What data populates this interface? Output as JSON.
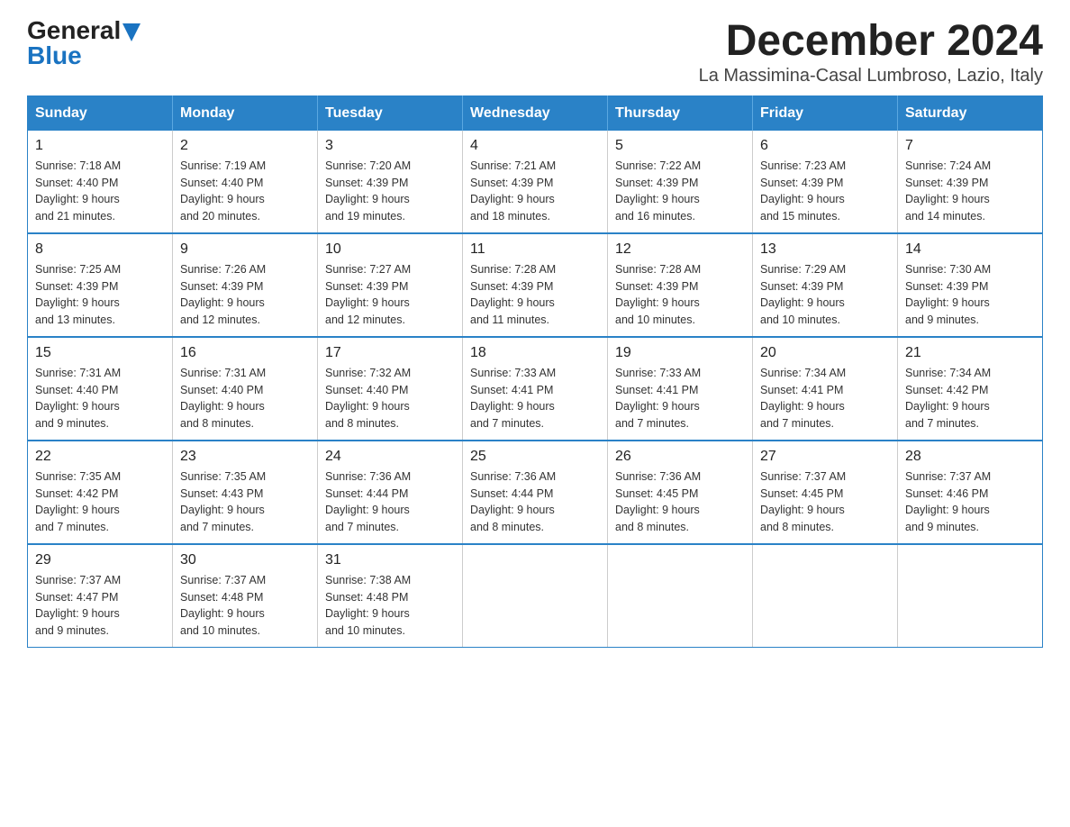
{
  "logo": {
    "general": "General",
    "blue": "Blue"
  },
  "title": "December 2024",
  "subtitle": "La Massimina-Casal Lumbroso, Lazio, Italy",
  "days_of_week": [
    "Sunday",
    "Monday",
    "Tuesday",
    "Wednesday",
    "Thursday",
    "Friday",
    "Saturday"
  ],
  "weeks": [
    [
      {
        "day": "1",
        "sunrise": "7:18 AM",
        "sunset": "4:40 PM",
        "daylight": "9 hours and 21 minutes."
      },
      {
        "day": "2",
        "sunrise": "7:19 AM",
        "sunset": "4:40 PM",
        "daylight": "9 hours and 20 minutes."
      },
      {
        "day": "3",
        "sunrise": "7:20 AM",
        "sunset": "4:39 PM",
        "daylight": "9 hours and 19 minutes."
      },
      {
        "day": "4",
        "sunrise": "7:21 AM",
        "sunset": "4:39 PM",
        "daylight": "9 hours and 18 minutes."
      },
      {
        "day": "5",
        "sunrise": "7:22 AM",
        "sunset": "4:39 PM",
        "daylight": "9 hours and 16 minutes."
      },
      {
        "day": "6",
        "sunrise": "7:23 AM",
        "sunset": "4:39 PM",
        "daylight": "9 hours and 15 minutes."
      },
      {
        "day": "7",
        "sunrise": "7:24 AM",
        "sunset": "4:39 PM",
        "daylight": "9 hours and 14 minutes."
      }
    ],
    [
      {
        "day": "8",
        "sunrise": "7:25 AM",
        "sunset": "4:39 PM",
        "daylight": "9 hours and 13 minutes."
      },
      {
        "day": "9",
        "sunrise": "7:26 AM",
        "sunset": "4:39 PM",
        "daylight": "9 hours and 12 minutes."
      },
      {
        "day": "10",
        "sunrise": "7:27 AM",
        "sunset": "4:39 PM",
        "daylight": "9 hours and 12 minutes."
      },
      {
        "day": "11",
        "sunrise": "7:28 AM",
        "sunset": "4:39 PM",
        "daylight": "9 hours and 11 minutes."
      },
      {
        "day": "12",
        "sunrise": "7:28 AM",
        "sunset": "4:39 PM",
        "daylight": "9 hours and 10 minutes."
      },
      {
        "day": "13",
        "sunrise": "7:29 AM",
        "sunset": "4:39 PM",
        "daylight": "9 hours and 10 minutes."
      },
      {
        "day": "14",
        "sunrise": "7:30 AM",
        "sunset": "4:39 PM",
        "daylight": "9 hours and 9 minutes."
      }
    ],
    [
      {
        "day": "15",
        "sunrise": "7:31 AM",
        "sunset": "4:40 PM",
        "daylight": "9 hours and 9 minutes."
      },
      {
        "day": "16",
        "sunrise": "7:31 AM",
        "sunset": "4:40 PM",
        "daylight": "9 hours and 8 minutes."
      },
      {
        "day": "17",
        "sunrise": "7:32 AM",
        "sunset": "4:40 PM",
        "daylight": "9 hours and 8 minutes."
      },
      {
        "day": "18",
        "sunrise": "7:33 AM",
        "sunset": "4:41 PM",
        "daylight": "9 hours and 7 minutes."
      },
      {
        "day": "19",
        "sunrise": "7:33 AM",
        "sunset": "4:41 PM",
        "daylight": "9 hours and 7 minutes."
      },
      {
        "day": "20",
        "sunrise": "7:34 AM",
        "sunset": "4:41 PM",
        "daylight": "9 hours and 7 minutes."
      },
      {
        "day": "21",
        "sunrise": "7:34 AM",
        "sunset": "4:42 PM",
        "daylight": "9 hours and 7 minutes."
      }
    ],
    [
      {
        "day": "22",
        "sunrise": "7:35 AM",
        "sunset": "4:42 PM",
        "daylight": "9 hours and 7 minutes."
      },
      {
        "day": "23",
        "sunrise": "7:35 AM",
        "sunset": "4:43 PM",
        "daylight": "9 hours and 7 minutes."
      },
      {
        "day": "24",
        "sunrise": "7:36 AM",
        "sunset": "4:44 PM",
        "daylight": "9 hours and 7 minutes."
      },
      {
        "day": "25",
        "sunrise": "7:36 AM",
        "sunset": "4:44 PM",
        "daylight": "9 hours and 8 minutes."
      },
      {
        "day": "26",
        "sunrise": "7:36 AM",
        "sunset": "4:45 PM",
        "daylight": "9 hours and 8 minutes."
      },
      {
        "day": "27",
        "sunrise": "7:37 AM",
        "sunset": "4:45 PM",
        "daylight": "9 hours and 8 minutes."
      },
      {
        "day": "28",
        "sunrise": "7:37 AM",
        "sunset": "4:46 PM",
        "daylight": "9 hours and 9 minutes."
      }
    ],
    [
      {
        "day": "29",
        "sunrise": "7:37 AM",
        "sunset": "4:47 PM",
        "daylight": "9 hours and 9 minutes."
      },
      {
        "day": "30",
        "sunrise": "7:37 AM",
        "sunset": "4:48 PM",
        "daylight": "9 hours and 10 minutes."
      },
      {
        "day": "31",
        "sunrise": "7:38 AM",
        "sunset": "4:48 PM",
        "daylight": "9 hours and 10 minutes."
      },
      null,
      null,
      null,
      null
    ]
  ],
  "labels": {
    "sunrise": "Sunrise:",
    "sunset": "Sunset:",
    "daylight": "Daylight:"
  }
}
